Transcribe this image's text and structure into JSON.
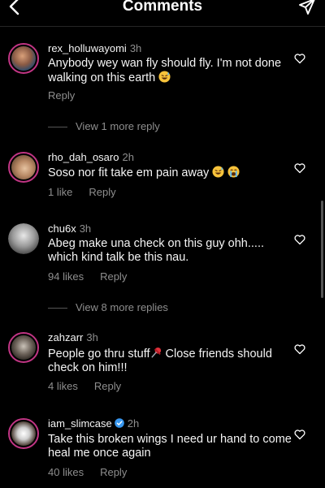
{
  "header": {
    "title": "Comments",
    "back_icon": "chevron-left-icon",
    "send_icon": "paper-plane-icon"
  },
  "comments": [
    {
      "username": "rex_holluwayomi",
      "time": "3h",
      "text": "Anybody wey wan fly should fly. I'm not done walking on this earth",
      "emojis": [
        "grinning-sweat-emoji"
      ],
      "likes": "",
      "reply": "Reply",
      "view_more": "View 1 more reply"
    },
    {
      "username": "rho_dah_osaro",
      "time": "2h",
      "text": "Soso nor fit take em pain away",
      "emojis": [
        "grinning-sweat-emoji",
        "loudly-crying-emoji"
      ],
      "likes": "1 like",
      "reply": "Reply",
      "view_more": ""
    },
    {
      "username": "chu6x",
      "time": "3h",
      "text": "Abeg make una check on this guy ohh..... which kind talk be this nau.",
      "emojis": [],
      "likes": "94 likes",
      "reply": "Reply",
      "view_more": "View 8 more replies"
    },
    {
      "username": "zahzarr",
      "time": "3h",
      "text_before": "People go thru stuff",
      "text_after": " Close friends should check on him!!!",
      "emojis": [
        "pushpin-emoji"
      ],
      "likes": "4 likes",
      "reply": "Reply",
      "view_more": ""
    },
    {
      "username": "iam_slimcase",
      "time": "2h",
      "verified": true,
      "text": "Take this broken wings I need ur hand to come heal me once again",
      "emojis": [],
      "likes": "40 likes",
      "reply": "Reply",
      "view_more": ""
    }
  ],
  "colors": {
    "background": "#000000",
    "text": "#f5f5f5",
    "muted": "#8e8e8e",
    "story_ring": "#c13584",
    "verified": "#3897f0"
  }
}
